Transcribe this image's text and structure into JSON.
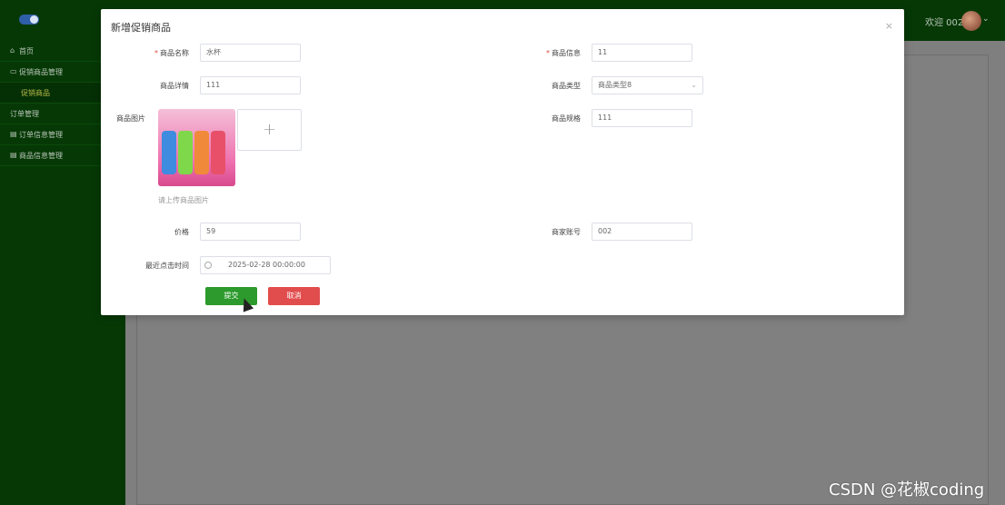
{
  "header": {
    "welcome_text": "欢迎 002"
  },
  "sidebar": {
    "items": [
      {
        "label": "首页",
        "icon": "home-icon"
      },
      {
        "label": "促销商品管理",
        "icon": "folder-icon"
      },
      {
        "label": "促销商品",
        "icon": ""
      },
      {
        "label": "订单管理",
        "icon": ""
      },
      {
        "label": "订单信息管理",
        "icon": "document-icon"
      },
      {
        "label": "商品信息管理",
        "icon": "document-icon"
      }
    ]
  },
  "modal": {
    "title": "新增促销商品",
    "close_label": "×",
    "fields": {
      "name": {
        "label": "商品名称",
        "value": "水杯"
      },
      "info": {
        "label": "商品信息",
        "value": "11"
      },
      "detail": {
        "label": "商品详情",
        "value": "111"
      },
      "type": {
        "label": "商品类型",
        "value": "商品类型8"
      },
      "image": {
        "label": "商品图片",
        "hint": "请上传商品图片",
        "upload_symbol": "+"
      },
      "spec": {
        "label": "商品规格",
        "value": "111"
      },
      "price": {
        "label": "价格",
        "value": "59"
      },
      "merchant": {
        "label": "商家账号",
        "value": "002"
      },
      "last_click": {
        "label": "最近点击时间",
        "value": "2025-02-28 00:00:00"
      }
    },
    "submit_label": "提交",
    "cancel_label": "取消"
  },
  "watermark": "CSDN @花椒coding",
  "colors": {
    "sidebar_bg": "#063806",
    "submit": "#2d9a2d",
    "cancel": "#e14c4c",
    "required": "#e04a4a"
  }
}
